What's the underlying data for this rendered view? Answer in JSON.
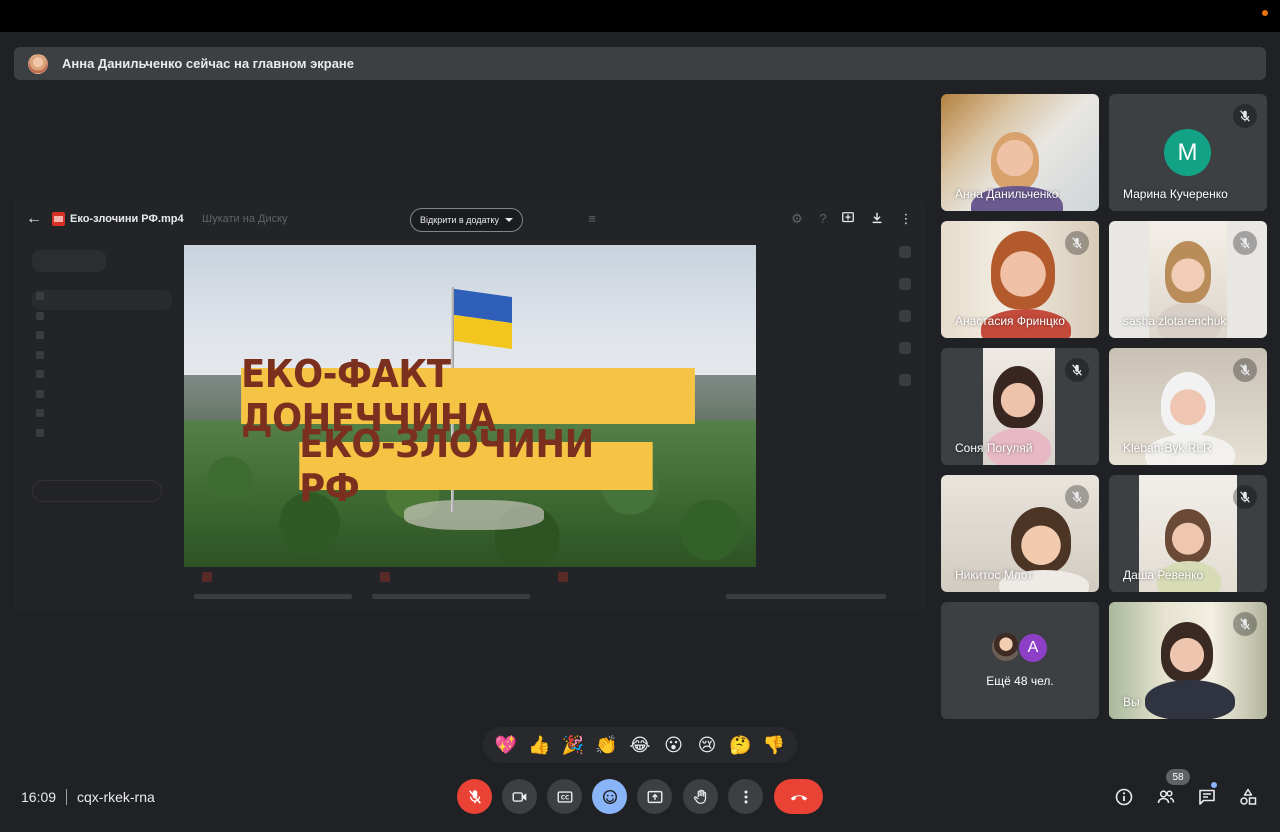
{
  "banner": {
    "text": "Анна Данильченко сейчас на главном экране"
  },
  "presentation": {
    "file_name": "Еко-злочини РФ.mp4",
    "ghost_search": "Шукати на Диску",
    "open_with_label": "Відкрити в додатку",
    "video_caption_line1": "ЕКО-ФАКТ ДОНЕЧЧИНА",
    "video_caption_line2": "ЕКО-ЗЛОЧИНИ РФ"
  },
  "participants": [
    {
      "name": "Анна Данильченко",
      "muted": false,
      "avatar": null
    },
    {
      "name": "Марина Кучеренко",
      "muted": true,
      "avatar": "M"
    },
    {
      "name": "Анастасия Фринцко",
      "muted": true,
      "avatar": null
    },
    {
      "name": "sasha zlotarenchuk",
      "muted": true,
      "avatar": null
    },
    {
      "name": "Соня Погуляй",
      "muted": true,
      "avatar": null
    },
    {
      "name": "Kleban-Byk RLR",
      "muted": true,
      "avatar": null
    },
    {
      "name": "Никитос Млот",
      "muted": true,
      "avatar": null
    },
    {
      "name": "Даша Ревенко",
      "muted": true,
      "avatar": null
    },
    {
      "name": "Вы",
      "muted": true,
      "avatar": null
    }
  ],
  "more_tile": {
    "avatar_letter": "A",
    "text": "Ещё 48 чел."
  },
  "reactions": [
    "💖",
    "👍",
    "🎉",
    "👏",
    "😂",
    "😮",
    "😢",
    "🤔",
    "👎"
  ],
  "footer": {
    "time": "16:09",
    "meeting_code": "cqx-rkek-rna",
    "people_count": "58"
  },
  "colors": {
    "background": "#202124",
    "tile": "#3c4043",
    "end_call": "#ea4335",
    "accent_blue": "#8ab4f8",
    "avatar_m": "#12a386",
    "avatar_a": "#8e3fc7"
  },
  "icons": {
    "controls": [
      "mic-off-icon",
      "camera-icon",
      "captions-icon",
      "emoji-icon",
      "present-icon",
      "raise-hand-icon",
      "more-options-icon",
      "end-call-icon"
    ],
    "right": [
      "info-icon",
      "people-icon",
      "chat-icon",
      "activities-icon"
    ]
  }
}
